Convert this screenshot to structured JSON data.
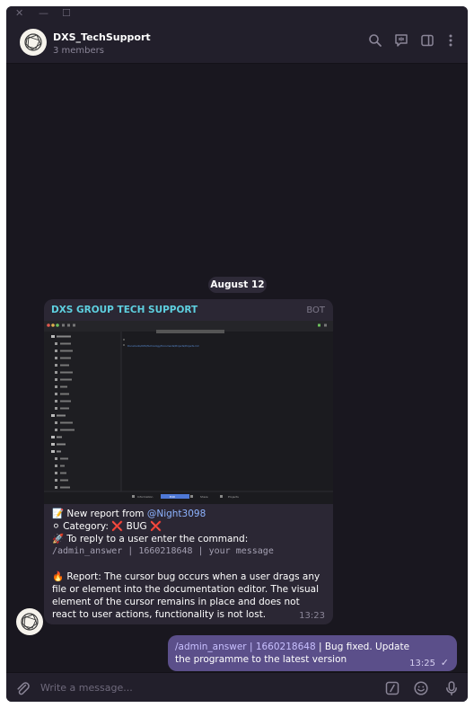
{
  "window": {
    "controls": {
      "close": "✕",
      "minimize": "—",
      "maximize": "☐"
    }
  },
  "chat": {
    "title": "DXS_TechSupport",
    "subtitle": "3 members",
    "icons": [
      "search-icon",
      "video-chat-icon",
      "sidebar-toggle-icon",
      "more-vertical-icon"
    ]
  },
  "date_separator": "August 12",
  "messages": [
    {
      "sender": "DXS GROUP TECH SUPPORT",
      "badge": "BOT",
      "screenshot": {
        "path_text": "Documents/DXS/Technology/Documents/Projects/Projects.md",
        "bottom_tabs": [
          "Information",
          "Edit",
          "Share",
          "Projects"
        ]
      },
      "lines": {
        "new_report_emoji": "📝",
        "new_report_prefix": "New report from ",
        "new_report_user": "@Night3098",
        "category_emoji": "⚪",
        "category": "Category: ❌ BUG ❌",
        "reply_emoji": "🚀",
        "reply_instruction": "To reply to a user enter the command:",
        "command": "/admin_answer | 1660218648 | your message",
        "report_emoji": "🔥",
        "report": "Report: The cursor bug occurs when a user drags any file or element into the documentation editor. The visual element of the cursor remains in place and does not react to user actions, functionality is not lost."
      },
      "time": "13:23"
    },
    {
      "command": "/admin_answer | 1660218648",
      "text": " | Bug fixed. Update the programme to the latest version",
      "time": "13:25",
      "status": "✓"
    }
  ],
  "composer": {
    "placeholder": "Write a message...",
    "icons": [
      "attach-icon",
      "command-icon",
      "emoji-icon",
      "microphone-icon"
    ]
  },
  "colors": {
    "background": "#19171f",
    "header": "#221f2b",
    "incoming_bubble": "#2b2734",
    "outgoing_bubble": "#5b4f8a",
    "sender": "#5ed0e0",
    "link": "#8db3ff"
  }
}
